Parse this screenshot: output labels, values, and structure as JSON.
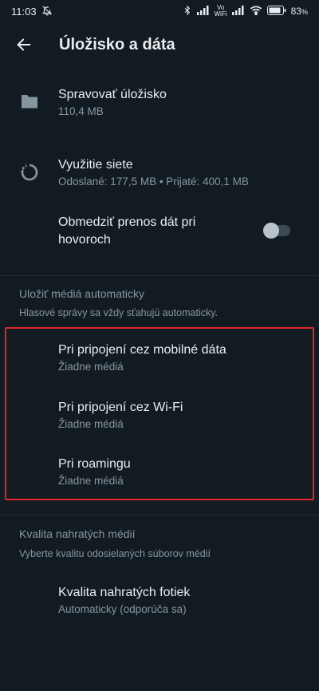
{
  "status": {
    "time": "11:03",
    "battery": "83"
  },
  "app_bar": {
    "title": "Úložisko a dáta"
  },
  "manage_storage": {
    "label": "Spravovať úložisko",
    "value": "110,4 MB"
  },
  "network_usage": {
    "label": "Využitie siete",
    "value": "Odoslané: 177,5 MB • Prijaté: 400,1 MB"
  },
  "limit_calls": {
    "label_line1": "Obmedziť prenos dát pri",
    "label_line2": "hovoroch",
    "enabled": false
  },
  "auto_download": {
    "header": "Uložiť médiá automaticky",
    "subtitle": "Hlasové správy sa vždy sťahujú automaticky.",
    "items": [
      {
        "label": "Pri pripojení cez mobilné dáta",
        "value": "Žiadne médiá"
      },
      {
        "label": "Pri pripojení cez Wi-Fi",
        "value": "Žiadne médiá"
      },
      {
        "label": "Pri roamingu",
        "value": "Žiadne médiá"
      }
    ]
  },
  "upload_quality": {
    "header": "Kvalita nahratých médií",
    "subtitle": "Vyberte kvalitu odosielaných súborov médií",
    "photo_quality_label": "Kvalita nahratých fotiek",
    "photo_quality_value": "Automaticky (odporúča sa)"
  },
  "colors": {
    "background": "#121b22",
    "primary_text": "#e9edef",
    "secondary_text": "#8696a0",
    "highlight": "#e3242b"
  }
}
